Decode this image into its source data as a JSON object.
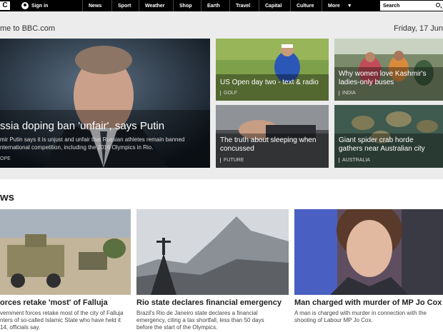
{
  "nav": {
    "logo": "C",
    "signin": "Sign in",
    "items": [
      "News",
      "Sport",
      "Weather",
      "Shop",
      "Earth",
      "Travel",
      "Capital",
      "Culture",
      "More"
    ],
    "search_placeholder": "Search"
  },
  "header": {
    "welcome": "me to BBC.com",
    "date": "Friday, 17 Jun"
  },
  "hero": {
    "title": "ssia doping ban 'unfair', says Putin",
    "desc_line1": "mir Putin says it is unjust and unfair that Russian athletes remain banned",
    "desc_line2": "nternational competition, including the 2016 Olympics in Rio.",
    "tag": "OPE"
  },
  "tiles": [
    {
      "title_line1": "US Open day two - text & radio",
      "title_line2": "",
      "tag": "GOLF"
    },
    {
      "title_line1": "Why women love Kashmir's",
      "title_line2": "ladies-only buses",
      "tag": "INDIA"
    },
    {
      "title_line1": "The truth about sleeping when",
      "title_line2": "concussed",
      "tag": "FUTURE"
    },
    {
      "title_line1": "Giant spider crab horde",
      "title_line2": "gathers near Australian city",
      "tag": "AUSTRALIA"
    }
  ],
  "news": {
    "heading": "ws",
    "stories": [
      {
        "title": "orces retake 'most' of Falluja",
        "desc_line1": "vernment forces retake most of the city of Falluja",
        "desc_line2": "nters of so-called Islamic State who have held it",
        "desc_line3": "14, officials say."
      },
      {
        "title": "Rio state declares financial emergency",
        "desc_line1": "Brazil's Rio de Janeiro state declares a financial",
        "desc_line2": "emergency, citing a tax shortfall, less than 50 days",
        "desc_line3": "before the start of the Olympics."
      },
      {
        "title": "Man charged with murder of MP Jo Cox",
        "desc_line1": "A man is charged with murder in connection with the",
        "desc_line2": "shooting of Labour MP Jo Cox.",
        "desc_line3": ""
      }
    ]
  }
}
